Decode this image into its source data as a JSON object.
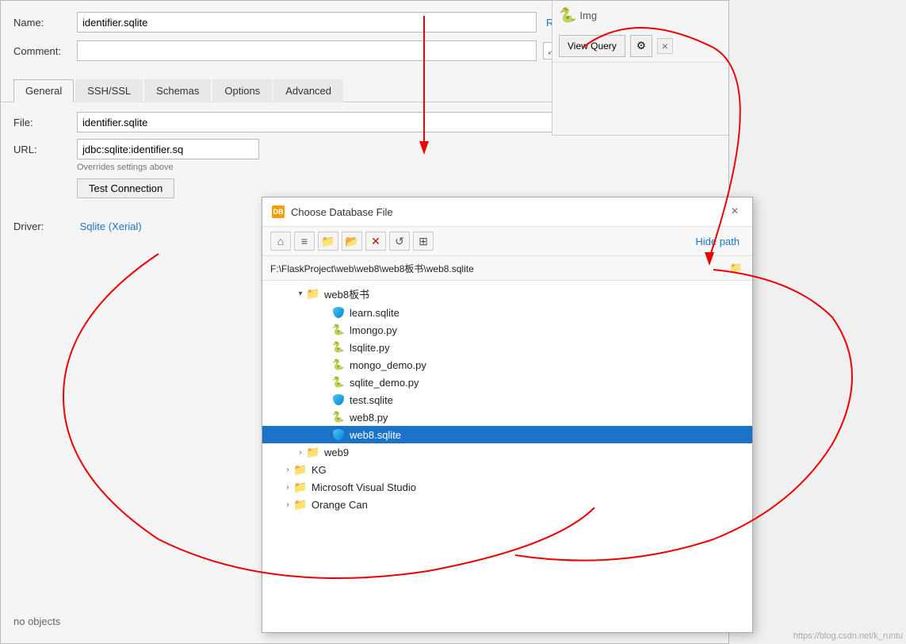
{
  "main_dialog": {
    "name_label": "Name:",
    "name_value": "identifier.sqlite",
    "reset_label": "Reset",
    "comment_label": "Comment:",
    "comment_value": "",
    "tabs": [
      "General",
      "SSH/SSL",
      "Schemas",
      "Options",
      "Advanced"
    ],
    "active_tab": "General",
    "file_label": "File:",
    "file_value": "identifier.sqlite",
    "url_label": "URL:",
    "url_value": "jdbc:sqlite:identifier.sq",
    "overrides_text": "Overrides settings above",
    "test_conn_label": "Test Connection",
    "driver_label": "Driver:",
    "driver_value": "Sqlite (Xerial)",
    "no_objects_label": "no objects",
    "view_query_label": "View Query"
  },
  "file_dialog": {
    "title": "Choose Database File",
    "close_label": "×",
    "hide_path_label": "Hide path",
    "path_value": "F:\\FlaskProject\\web\\web8\\web8板书\\web8.sqlite",
    "tree_items": [
      {
        "id": "web8bb",
        "label": "web8板书",
        "type": "folder",
        "indent": 2,
        "expanded": true,
        "expand_icon": "▾"
      },
      {
        "id": "learn_sqlite",
        "label": "learn.sqlite",
        "type": "sqlite",
        "indent": 4,
        "expanded": false,
        "expand_icon": ""
      },
      {
        "id": "lmongo_py",
        "label": "lmongo.py",
        "type": "python",
        "indent": 4,
        "expanded": false,
        "expand_icon": ""
      },
      {
        "id": "lsqlite_py",
        "label": "lsqlite.py",
        "type": "python",
        "indent": 4,
        "expanded": false,
        "expand_icon": ""
      },
      {
        "id": "mongo_demo_py",
        "label": "mongo_demo.py",
        "type": "python",
        "indent": 4,
        "expanded": false,
        "expand_icon": ""
      },
      {
        "id": "sqlite_demo_py",
        "label": "sqlite_demo.py",
        "type": "python",
        "indent": 4,
        "expanded": false,
        "expand_icon": ""
      },
      {
        "id": "test_sqlite",
        "label": "test.sqlite",
        "type": "sqlite",
        "indent": 4,
        "expanded": false,
        "expand_icon": ""
      },
      {
        "id": "web8_py",
        "label": "web8.py",
        "type": "python",
        "indent": 4,
        "expanded": false,
        "expand_icon": ""
      },
      {
        "id": "web8_sqlite",
        "label": "web8.sqlite",
        "type": "sqlite",
        "indent": 4,
        "expanded": false,
        "expand_icon": "",
        "selected": true
      },
      {
        "id": "web9",
        "label": "web9",
        "type": "folder",
        "indent": 2,
        "expanded": false,
        "expand_icon": "›"
      },
      {
        "id": "kg",
        "label": "KG",
        "type": "folder",
        "indent": 1,
        "expanded": false,
        "expand_icon": "›"
      },
      {
        "id": "mvs",
        "label": "Microsoft Visual Studio",
        "type": "folder",
        "indent": 1,
        "expanded": false,
        "expand_icon": "›"
      },
      {
        "id": "orange",
        "label": "Orange Can",
        "type": "folder",
        "indent": 1,
        "expanded": false,
        "expand_icon": "›"
      }
    ],
    "toolbar_buttons": [
      "home",
      "list",
      "folder",
      "new-folder",
      "delete",
      "refresh",
      "grid"
    ]
  },
  "right_panel": {
    "img_label": "Img",
    "close_label": "×"
  },
  "icons": {
    "home": "⌂",
    "list": "≡",
    "folder": "📁",
    "new_folder": "📂",
    "delete": "✕",
    "refresh": "↺",
    "grid": "⊞",
    "gear": "⚙",
    "browse": "…",
    "add": "+",
    "expand": "⤢"
  }
}
